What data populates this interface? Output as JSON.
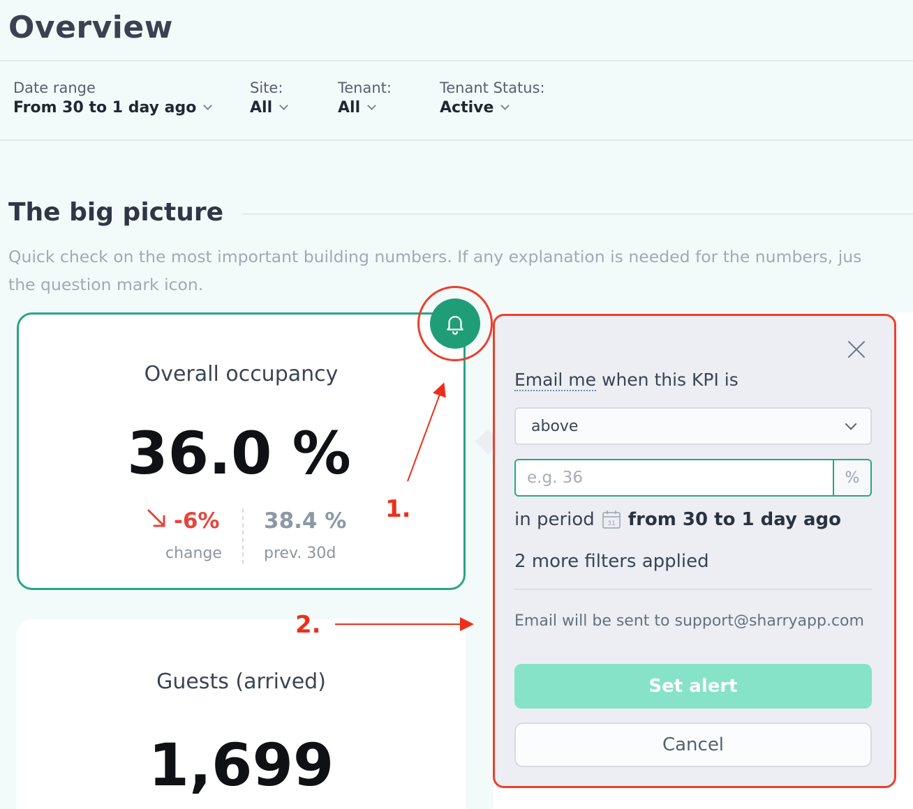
{
  "header": {
    "title": "Overview"
  },
  "filters": [
    {
      "label": "Date range",
      "value": "From 30 to 1 day ago"
    },
    {
      "label": "Site:",
      "value": "All"
    },
    {
      "label": "Tenant:",
      "value": "All"
    },
    {
      "label": "Tenant Status:",
      "value": "Active"
    }
  ],
  "section": {
    "title": "The big picture",
    "description_line1": "Quick check on the most important building numbers. If any explanation is needed for the numbers, jus",
    "description_line2": "the question mark icon."
  },
  "kpis": {
    "occupancy": {
      "title": "Overall occupancy",
      "value": "36.0 %",
      "change": "-6%",
      "change_label": "change",
      "prev_value": "38.4 %",
      "prev_label": "prev. 30d"
    },
    "guests": {
      "title": "Guests (arrived)",
      "value": "1,699"
    }
  },
  "annotations": {
    "one": "1.",
    "two": "2."
  },
  "alert_popover": {
    "heading_prefix": "Email me",
    "heading_suffix": " when this KPI is",
    "condition": "above",
    "threshold_placeholder": "e.g. 36",
    "threshold_value": "",
    "unit": "%",
    "period_label": "in period",
    "period_value": "from 30 to 1 day ago",
    "filters_note": "2 more filters applied",
    "email_note": "Email will be sent to support@sharryapp.com",
    "set_alert_label": "Set alert",
    "cancel_label": "Cancel"
  },
  "icons": {
    "bell": "bell-icon",
    "close": "close-icon",
    "calendar": "calendar-icon",
    "change_arrow": "arrow-down-right-icon"
  },
  "colors": {
    "accent": "#26a683",
    "bell_bg": "#1f9d76",
    "negative": "#e4453b",
    "annotation": "#ec3f2c",
    "set_alert_bg": "#86e3c7"
  }
}
